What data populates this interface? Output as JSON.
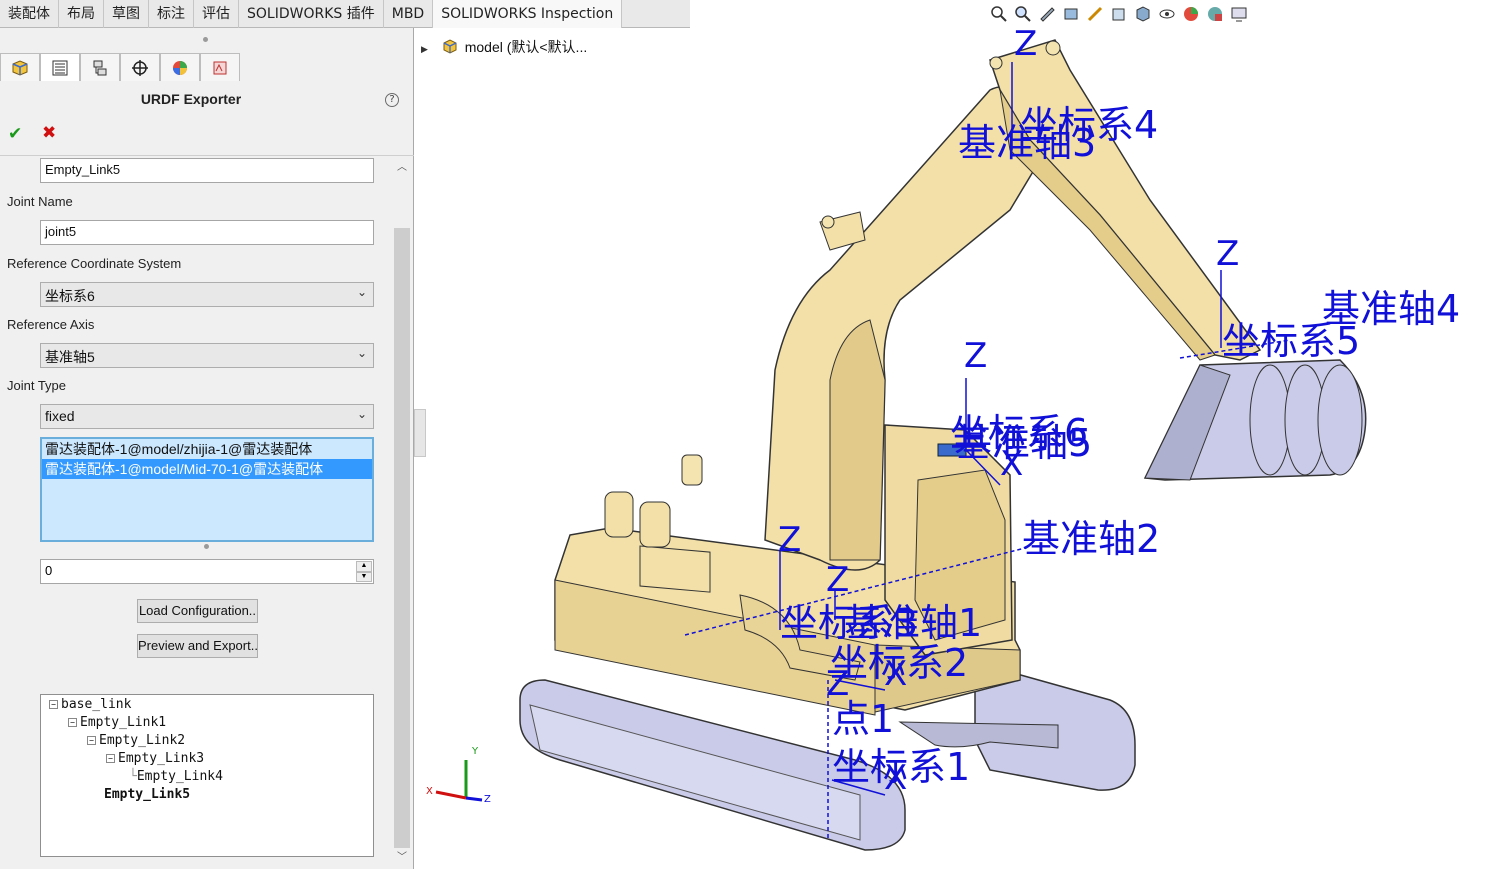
{
  "tabs": [
    {
      "label": "装配体",
      "active": false
    },
    {
      "label": "布局",
      "active": false
    },
    {
      "label": "草图",
      "active": false
    },
    {
      "label": "标注",
      "active": false
    },
    {
      "label": "评估",
      "active": false
    },
    {
      "label": "SOLIDWORKS 插件",
      "active": false
    },
    {
      "label": "MBD",
      "active": false
    },
    {
      "label": "SOLIDWORKS Inspection",
      "active": true
    }
  ],
  "panel": {
    "title": "URDF Exporter",
    "link_name_value": "Empty_Link5",
    "joint_name_label": "Joint Name",
    "joint_name_value": "joint5",
    "ref_coord_label": "Reference Coordinate System",
    "ref_coord_value": "坐标系6",
    "ref_axis_label": "Reference Axis",
    "ref_axis_value": "基准轴5",
    "joint_type_label": "Joint Type",
    "joint_type_value": "fixed",
    "components": [
      {
        "text": "雷达装配体-1@model/zhijia-1@雷达装配体",
        "selected": false
      },
      {
        "text": "雷达装配体-1@model/Mid-70-1@雷达装配体",
        "selected": true
      }
    ],
    "spin_value": "0",
    "load_button": "Load Configuration..",
    "preview_button": "Preview and Export..",
    "tree": [
      {
        "label": "base_link",
        "indent": 0,
        "box": "−",
        "bold": false
      },
      {
        "label": "Empty_Link1",
        "indent": 1,
        "box": "−",
        "bold": false
      },
      {
        "label": "Empty_Link2",
        "indent": 2,
        "box": "−",
        "bold": false
      },
      {
        "label": "Empty_Link3",
        "indent": 3,
        "box": "−",
        "bold": false
      },
      {
        "label": "Empty_Link4",
        "indent": 4,
        "box": "",
        "bold": false
      },
      {
        "label": "Empty_Link5",
        "indent": 2,
        "box": "",
        "bold": true
      }
    ]
  },
  "feature_tree": {
    "root": "model  (默认<默认..."
  },
  "annotations": [
    {
      "text": "基准轴3"
    },
    {
      "text": "坐标系4"
    },
    {
      "text": "Z"
    },
    {
      "text": "基准轴4"
    },
    {
      "text": "坐标系5"
    },
    {
      "text": "Z"
    },
    {
      "text": "Z"
    },
    {
      "text": "坐标系6"
    },
    {
      "text": "基准轴5"
    },
    {
      "text": "X"
    },
    {
      "text": "基准轴2"
    },
    {
      "text": "Z"
    },
    {
      "text": "坐标系3"
    },
    {
      "text": "基准轴1"
    },
    {
      "text": "坐标系2"
    },
    {
      "text": "X"
    },
    {
      "text": "点1"
    },
    {
      "text": "坐标系1"
    },
    {
      "text": "X"
    },
    {
      "text": "Z"
    },
    {
      "text": "Z"
    }
  ],
  "triad": {
    "x": "X",
    "y": "Y",
    "z": "Z"
  },
  "colors": {
    "annotation": "#1010d8",
    "model": "#f2e0a8",
    "track": "#c9cbe8",
    "selection": "#3399ff"
  }
}
